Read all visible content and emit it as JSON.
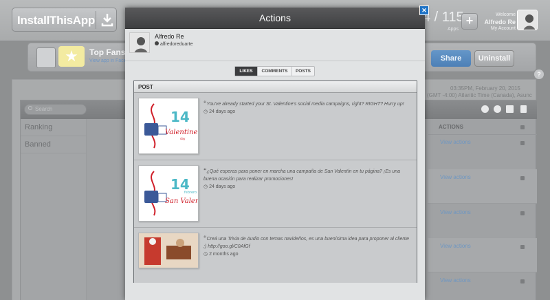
{
  "header": {
    "logo": "InstallThisApp",
    "apps_count": "4 / 115",
    "apps_label": "Apps",
    "welcome_label": "Welcome",
    "user_name": "Alfredo Re",
    "account_link": "My Account"
  },
  "app": {
    "title": "Top Fans",
    "subtitle": "View app in Faceb",
    "share_label": "Share",
    "uninstall_label": "Uninstall",
    "help_label": "?"
  },
  "main": {
    "date_line1": "03:35PM, February 20, 2015",
    "date_line2": "(GMT -4:00) Atlantic Time (Canada), Asunc",
    "search_placeholder": "Search",
    "sidebar": [
      {
        "label": "Ranking"
      },
      {
        "label": "Banned"
      }
    ],
    "actions_header": "ACTIONS",
    "rows": [
      {
        "action": "View actions"
      },
      {
        "action": "View actions"
      },
      {
        "action": "View actions"
      },
      {
        "action": "View actions"
      },
      {
        "action": "View actions"
      }
    ]
  },
  "modal": {
    "title": "Actions",
    "close_label": "✕",
    "user": {
      "name": "Alfredo Re",
      "handle": "alfredoreduarte"
    },
    "tabs": [
      {
        "label": "LIKES",
        "active": true
      },
      {
        "label": "COMMENTS",
        "active": false
      },
      {
        "label": "POSTS",
        "active": false
      }
    ],
    "posts_header": "POST",
    "posts": [
      {
        "text": "You've already started your St. Valentine's social media campaigns, right? RIGHT? Hurry up!",
        "time": "24 days ago",
        "image": "14 Valentine's Day"
      },
      {
        "text": "¿Qué esperas para poner en marcha una campaña de San Valentín en tu página? ¡Es una buena ocasión para realizar promociones!",
        "time": "24 days ago",
        "image": "14 febrero San Valentín"
      },
      {
        "text": "Creá una Trivia de Audio con temas navideños, es una buenísima idea para proponer al cliente ;) http://goo.gl/C0AfGf",
        "time": "2 months ago",
        "image": "christmas-photo"
      }
    ]
  },
  "colors": {
    "accent": "#4d80b7",
    "link": "#6f97c2",
    "modal_header": "#3e3f41",
    "close": "#1e73c6"
  }
}
